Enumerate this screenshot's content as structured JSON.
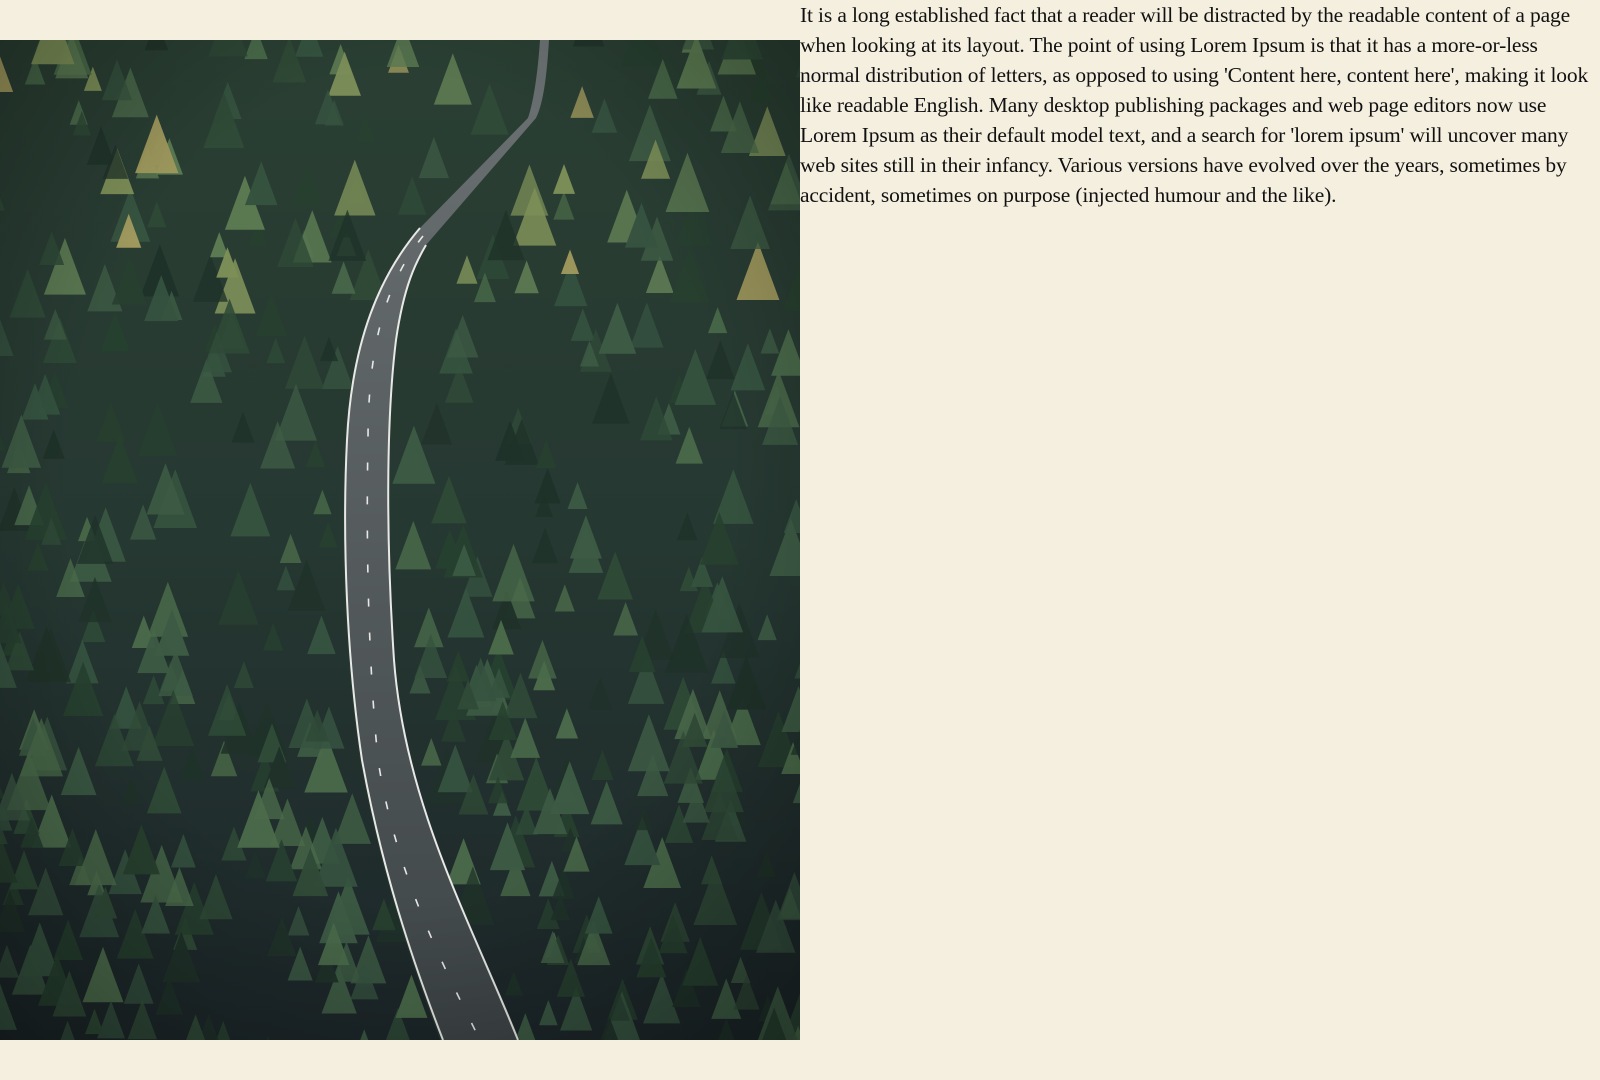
{
  "colors": {
    "page_background": "#f5efe0",
    "forest_dark": "#1f2b2b",
    "forest_mid": "#2f4a3c",
    "foliage_light": "#8a9a5b",
    "road": "#4a5152",
    "road_line": "#e8e8e6",
    "text": "#111111"
  },
  "photo": {
    "subject": "aerial-forest-road"
  },
  "article": {
    "paragraph": "It is a long established fact that a reader will be distracted by the readable content of a page when looking at its layout. The point of using Lorem Ipsum is that it has a more-or-less normal distribution of letters, as opposed to using 'Content here, content here', making it look like readable English. Many desktop publishing packages and web page editors now use Lorem Ipsum as their default model text, and a search for 'lorem ipsum' will uncover many web sites still in their infancy. Various versions have evolved over the years, sometimes by accident, sometimes on purpose (injected humour and the like)."
  }
}
